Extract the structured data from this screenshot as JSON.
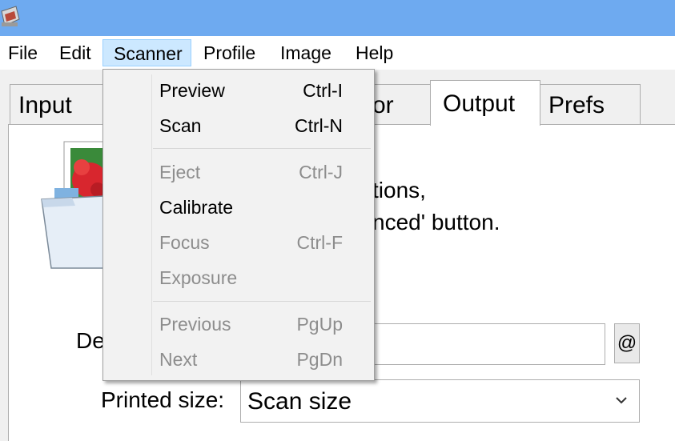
{
  "colors": {
    "titlebar": "#6eaaf0",
    "menu_highlight": "#cce8ff",
    "disabled_text": "#8d8d8d"
  },
  "menubar": {
    "items": [
      {
        "label": "File"
      },
      {
        "label": "Edit"
      },
      {
        "label": "Scanner"
      },
      {
        "label": "Profile"
      },
      {
        "label": "Image"
      },
      {
        "label": "Help"
      }
    ],
    "active": "Scanner"
  },
  "tabs": [
    {
      "label": "Input"
    },
    {
      "label": "or"
    },
    {
      "label": "Output"
    },
    {
      "label": "Prefs"
    }
  ],
  "selected_tab": "Output",
  "content": {
    "line1": "tions,",
    "line2": "nced' button.",
    "field_label_partial": "De",
    "at_button": "@",
    "printed_size_label": "Printed size:",
    "printed_size_value": "Scan size"
  },
  "scanner_menu": {
    "items": [
      {
        "label": "Preview",
        "shortcut": "Ctrl-I",
        "enabled": true
      },
      {
        "label": "Scan",
        "shortcut": "Ctrl-N",
        "enabled": true
      },
      {
        "label": "Eject",
        "shortcut": "Ctrl-J",
        "enabled": false
      },
      {
        "label": "Calibrate",
        "shortcut": "",
        "enabled": true
      },
      {
        "label": "Focus",
        "shortcut": "Ctrl-F",
        "enabled": false
      },
      {
        "label": "Exposure",
        "shortcut": "",
        "enabled": false
      },
      {
        "label": "Previous",
        "shortcut": "PgUp",
        "enabled": false
      },
      {
        "label": "Next",
        "shortcut": "PgDn",
        "enabled": false
      }
    ]
  }
}
